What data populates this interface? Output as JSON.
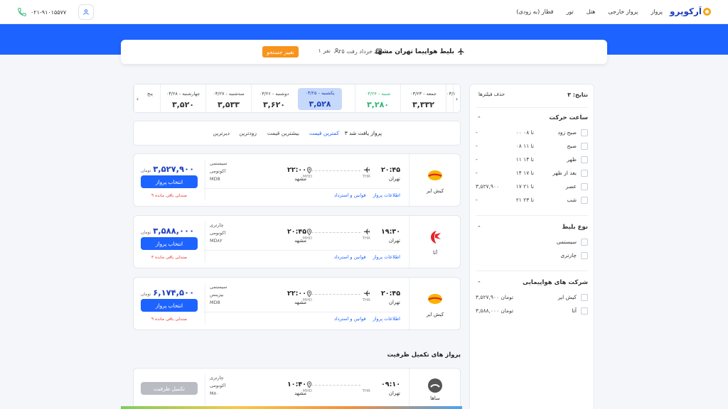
{
  "header": {
    "logo_text": "اَرکوپرو",
    "nav": [
      "پرواز",
      "پرواز خارجی",
      "هتل",
      "تور",
      "قطار (به زودی)"
    ],
    "phone": "۰۲۱-۹۱۰۱۵۵۷۷"
  },
  "search": {
    "title": "بلیط هواپیما تهران مشهد",
    "date": "۲۵ خرداد رفت",
    "passengers": "۱ نفر",
    "change_button": "تغییر جستجو"
  },
  "filters": {
    "results": "نتایج: ۳",
    "clear": "حذف فیلترها",
    "time_title": "ساعت حرکت",
    "time_rows": [
      {
        "label": "صبح زود",
        "range": "۰۰ تا ۰۸",
        "value": "-"
      },
      {
        "label": "صبح",
        "range": "۰۸ تا ۱۱",
        "value": "-"
      },
      {
        "label": "ظهر",
        "range": "۱۱ تا ۱۴",
        "value": "-"
      },
      {
        "label": "بعد از ظهر",
        "range": "۱۴ تا ۱۷",
        "value": "-"
      },
      {
        "label": "عصر",
        "range": "۱۷ تا ۲۱",
        "value": "۳,۵۲۷,۹۰۰"
      },
      {
        "label": "شب",
        "range": "۲۱ تا ۲۳",
        "value": "-"
      }
    ],
    "ticket_title": "نوع بلیط",
    "ticket_rows": [
      "سیستمی",
      "چارتری"
    ],
    "airline_title": "شرکت های هواپیمایی",
    "airline_rows": [
      {
        "label": "کیش ایر",
        "value": "۳,۵۲۷,۹۰۰ تومان"
      },
      {
        "label": "آتا",
        "value": "۳,۵۸۸,۰۰۰ تومان"
      }
    ]
  },
  "dates": [
    {
      "label": "۰۳/۱",
      "price": ""
    },
    {
      "label": "جمعه - ۰۳/۲۳",
      "price": "۳,۳۳۲"
    },
    {
      "label": "شنبه - ۰۳/۲۴",
      "price": "۳,۲۸۰"
    },
    {
      "label": "یکشنبه - ۰۳/۲۵",
      "price": "۳,۵۲۸"
    },
    {
      "label": "دوشنبه - ۰۳/۲۶",
      "price": "۳,۶۲۰"
    },
    {
      "label": "سه‌شنبه - ۰۳/۲۷",
      "price": "۳,۵۳۳"
    },
    {
      "label": "چهارشنبه - ۰۳/۲۸",
      "price": "۳,۵۲۰"
    },
    {
      "label": "پنج",
      "price": ""
    }
  ],
  "sort": {
    "count": "۳ پرواز یافت شد",
    "options": [
      "کمترین قیمت",
      "بیشترین قیمت",
      "زودترین",
      "دیرترین"
    ]
  },
  "flights": [
    {
      "airline": "کیش ایر",
      "dep_time": "۲۰:۴۵",
      "dep_city": "تهران",
      "dep_code": "THR",
      "arr_time": "۲۲:۰۰",
      "arr_city": "مشهد",
      "arr_code": "MHD",
      "info_link": "اطلاعات پرواز",
      "rules_link": "قوانین و استرداد",
      "type": "سیستمی",
      "class": "اکونومی",
      "aircraft": "MD8",
      "price": "۳,۵۲۷,۹۰۰",
      "unit": "تومان",
      "button": "انتخاب پرواز",
      "seats": "۹ صندلی باقی مانده"
    },
    {
      "airline": "آتا",
      "dep_time": "۱۹:۳۰",
      "dep_city": "تهران",
      "dep_code": "THR",
      "arr_time": "۲۰:۴۵",
      "arr_city": "مشهد",
      "arr_code": "MHD",
      "info_link": "اطلاعات پرواز",
      "rules_link": "قوانین و استرداد",
      "type": "چارتری",
      "class": "اکونومی",
      "aircraft": "MD۸۲",
      "price": "۳,۵۸۸,۰۰۰",
      "unit": "تومان",
      "button": "انتخاب پرواز",
      "seats": "۳ صندلی باقی مانده"
    },
    {
      "airline": "کیش ایر",
      "dep_time": "۲۰:۴۵",
      "dep_city": "تهران",
      "dep_code": "THR",
      "arr_time": "۲۲:۰۰",
      "arr_city": "مشهد",
      "arr_code": "MHD",
      "info_link": "اطلاعات پرواز",
      "rules_link": "قوانین و استرداد",
      "type": "سیستمی",
      "class": "بیزینس",
      "aircraft": "MD8",
      "price": "۶,۱۷۴,۵۰۰",
      "unit": "تومان",
      "button": "انتخاب پرواز",
      "seats": "۹ صندلی باقی مانده"
    }
  ],
  "full_section": {
    "title": "پرواز های تکمیل ظرفیت",
    "flight": {
      "airline": "ساها",
      "dep_time": "۰۹:۱۰",
      "dep_city": "تهران",
      "dep_code": "THR",
      "arr_time": "۱۰:۴۰",
      "arr_city": "مشهد",
      "arr_code": "MHD",
      "type": "چارتری",
      "class": "اکونومی",
      "aircraft": "M۸۰",
      "button": "تکمیل ظرفیت"
    }
  },
  "colors": {
    "primary": "#1d63ff",
    "accent": "#f7941d",
    "cheap": "#2bb673",
    "danger": "#e53935"
  }
}
